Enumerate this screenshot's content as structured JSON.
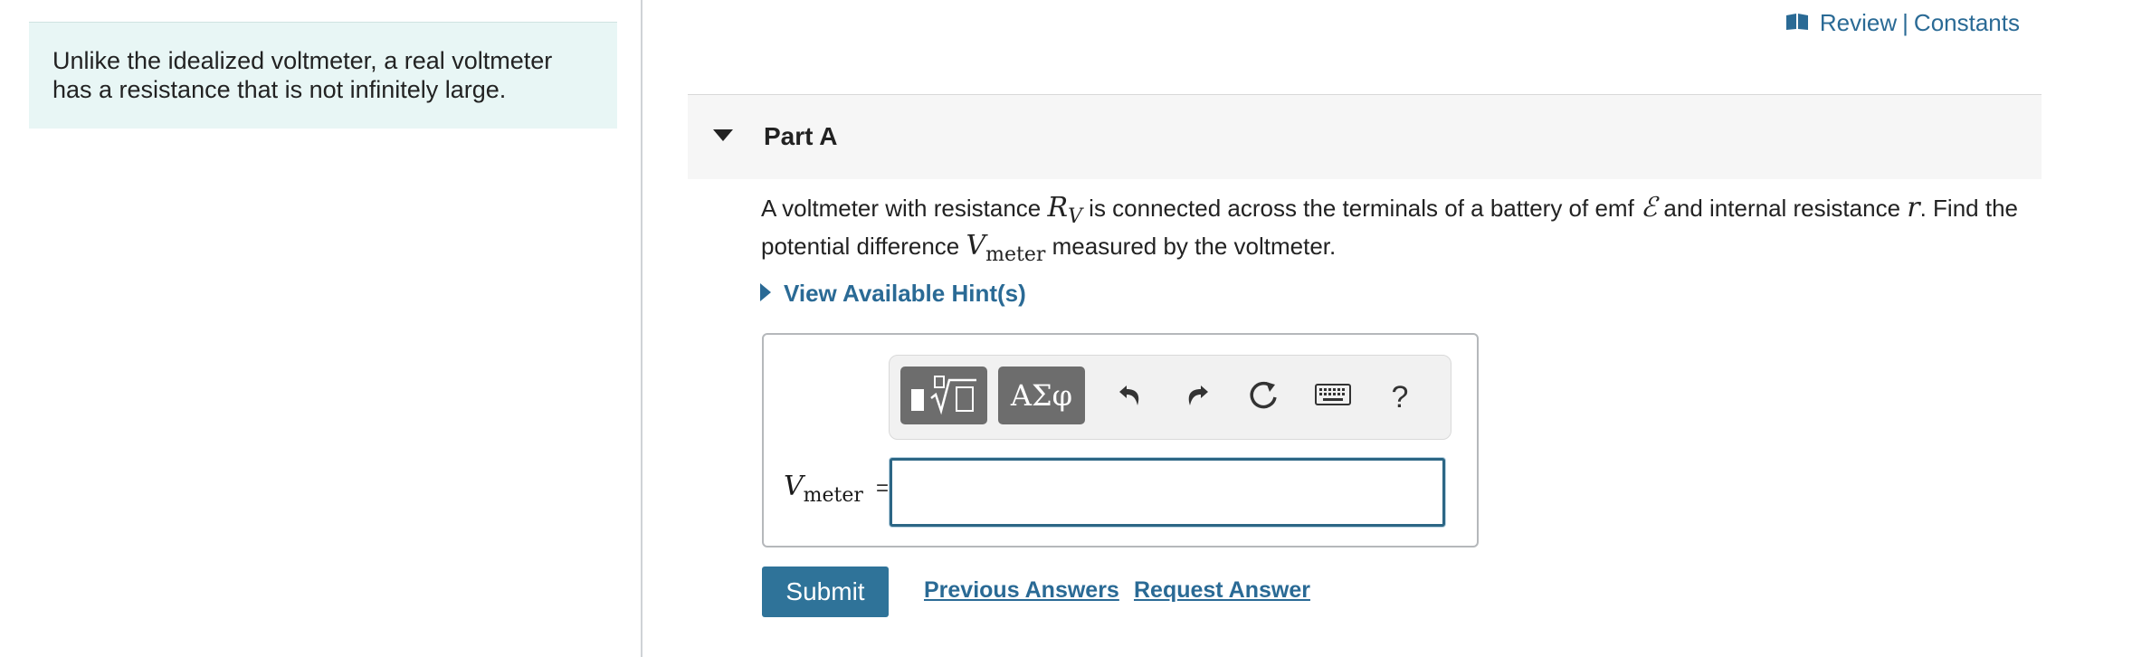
{
  "intro": {
    "text": "Unlike the idealized voltmeter, a real voltmeter has a resistance that is not infinitely large."
  },
  "top_links": {
    "icon": "book-icon",
    "review": "Review",
    "separator": "|",
    "constants": "Constants"
  },
  "part": {
    "title": "Part A",
    "expanded": true,
    "question": {
      "t1": "A voltmeter with resistance ",
      "m1_base": "R",
      "m1_sub": "V",
      "t2": " is connected across the terminals of a battery of emf ",
      "m2": "ℰ",
      "t3": " and internal resistance ",
      "m3": "r",
      "t4": ". Find the potential difference ",
      "m4_base": "V",
      "m4_sub": "meter",
      "t5": " measured by the voltmeter."
    },
    "hint_label": "View Available Hint(s)"
  },
  "answer": {
    "variable_base": "V",
    "variable_sub": "meter",
    "equals": "=",
    "value": "",
    "toolbar": {
      "templates_icon": "templates-icon",
      "greek_label": "ΑΣφ",
      "undo_icon": "undo-icon",
      "redo_icon": "redo-icon",
      "reset_icon": "reset-icon",
      "keyboard_icon": "keyboard-icon",
      "help_label": "?"
    }
  },
  "actions": {
    "submit": "Submit",
    "previous_answers": "Previous Answers",
    "request_answer": "Request Answer"
  },
  "colors": {
    "link": "#2a6a95",
    "submit_bg": "#2f7399",
    "intro_bg": "#e8f6f5",
    "input_border": "#2c6685"
  }
}
